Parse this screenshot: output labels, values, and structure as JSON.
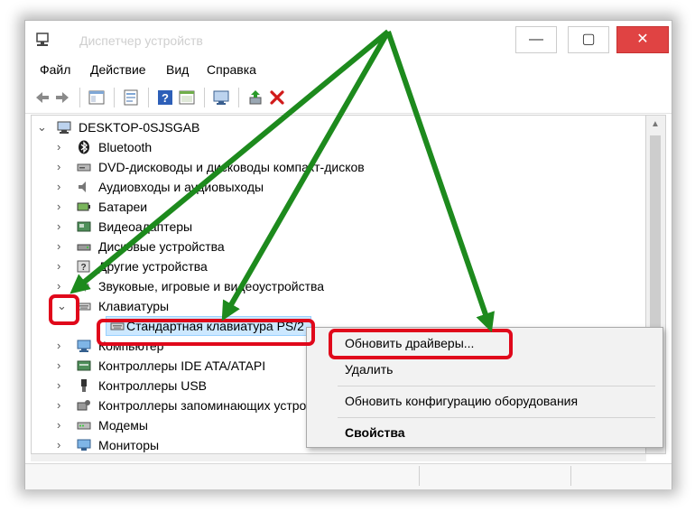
{
  "window": {
    "title": "Диспетчер устройств",
    "min_glyph": "—",
    "max_glyph": "▢",
    "close_glyph": "✕"
  },
  "menu": [
    "Файл",
    "Действие",
    "Вид",
    "Справка"
  ],
  "toolbar": {
    "icons": [
      "back-arrow-icon",
      "forward-arrow-icon",
      "console-tree-icon",
      "properties-icon",
      "help-icon",
      "view-icon",
      "monitor-icon",
      "update-driver-icon",
      "uninstall-icon"
    ]
  },
  "tree": {
    "root": "DESKTOP-0SJSGAB",
    "categories": [
      "Bluetooth",
      "DVD-дисководы и дисководы компакт-дисков",
      "Аудиовходы и аудиовыходы",
      "Батареи",
      "Видеоадаптеры",
      "Дисковые устройства",
      "Другие устройства",
      "Звуковые, игровые и видеоустройства",
      "Клавиатуры"
    ],
    "expanded_child": "Стандартная клавиатура PS/2",
    "categories_after": [
      "Компьютер",
      "Контроллеры IDE ATA/ATAPI",
      "Контроллеры USB",
      "Контроллеры запоминающих устройств",
      "Модемы",
      "Мониторы"
    ]
  },
  "context_menu": {
    "items": [
      "Обновить драйверы...",
      "Удалить",
      "Обновить конфигурацию оборудования",
      "Свойства"
    ]
  },
  "glyphs": {
    "collapsed": "›",
    "expanded": "⌄"
  },
  "colors": {
    "highlight": "#e0081b",
    "arrow": "#1d8a1d",
    "selection": "#cce8ff",
    "close": "#e04343"
  }
}
